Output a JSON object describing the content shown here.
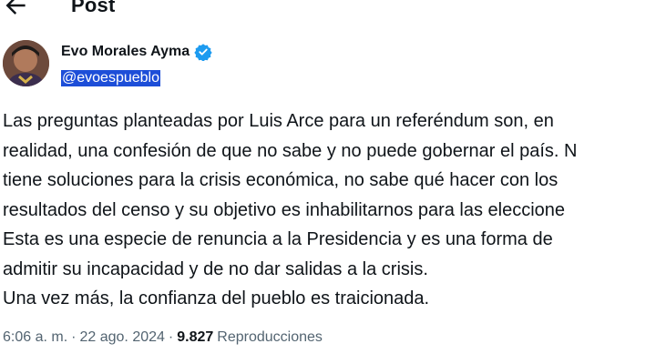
{
  "header": {
    "title": "Post",
    "back_icon": "arrow-left-icon"
  },
  "author": {
    "name": "Evo Morales Ayma",
    "handle": "@evoespueblo",
    "verified_icon": "verified-badge-icon",
    "avatar_icon": "avatar",
    "verified_color": "#1d9bf0"
  },
  "post": {
    "text": "Las preguntas planteadas por Luis Arce para un referéndum son, en\nrealidad, una confesión de que no sabe y no puede gobernar el país. N\ntiene soluciones para la crisis económica, no sabe qué hacer con los\nresultados del censo y su objetivo es inhabilitarnos para las eleccione\nEsta es una especie de renuncia a la Presidencia y es una forma de\nadmitir su incapacidad y de no dar salidas a la crisis.\nUna vez más, la confianza del pueblo es traicionada."
  },
  "meta": {
    "time": "6:06 a. m.",
    "sep1": "·",
    "date": "22 ago. 2024",
    "sep2": "·",
    "views": "9.827",
    "views_label": "Reproducciones"
  }
}
